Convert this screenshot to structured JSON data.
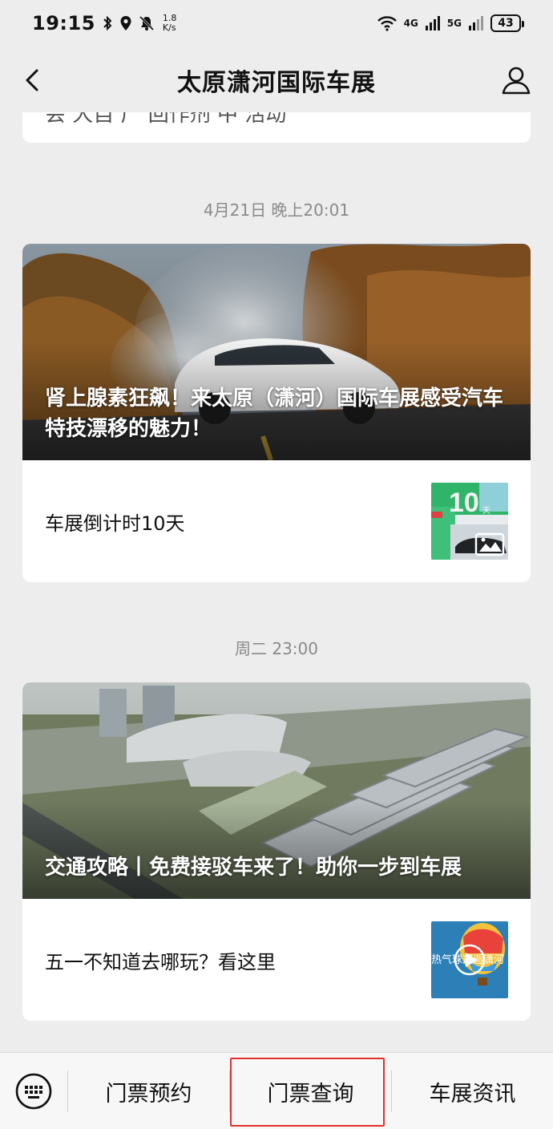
{
  "status_bar": {
    "time": "19:15",
    "speed_value": "1.8",
    "speed_unit": "K/s",
    "network_4g": "4G",
    "network_5g": "5G",
    "battery": "43",
    "icons": [
      "bluetooth-icon",
      "location-icon",
      "mute-icon",
      "wifi-icon",
      "signal-icon",
      "battery-icon"
    ]
  },
  "nav": {
    "title": "太原潇河国际车展"
  },
  "previous_card": {
    "partial_text": "会 大自 广 回作剂 中 活动"
  },
  "articles": [
    {
      "timestamp": "4月21日 晚上20:01",
      "headline": "肾上腺素狂飙！来太原（潇河）国际车展感受汽车特技漂移的魅力！",
      "sub_title": "车展倒计时10天",
      "thumb_text": "10",
      "thumb_unit": "天"
    },
    {
      "timestamp": "周二 23:00",
      "headline": "交通攻略丨免费接驳车来了！助你一步到车展",
      "sub_title": "五一不知道去哪玩？看这里",
      "thumb_text": "热气球邂逅潇河"
    }
  ],
  "menu": {
    "items": [
      "门票预约",
      "门票查询",
      "车展资讯"
    ]
  },
  "colors": {
    "background": "#ededed",
    "card": "#ffffff",
    "highlight_border": "#e0302a",
    "timestamp_text": "#8a8a8a"
  }
}
